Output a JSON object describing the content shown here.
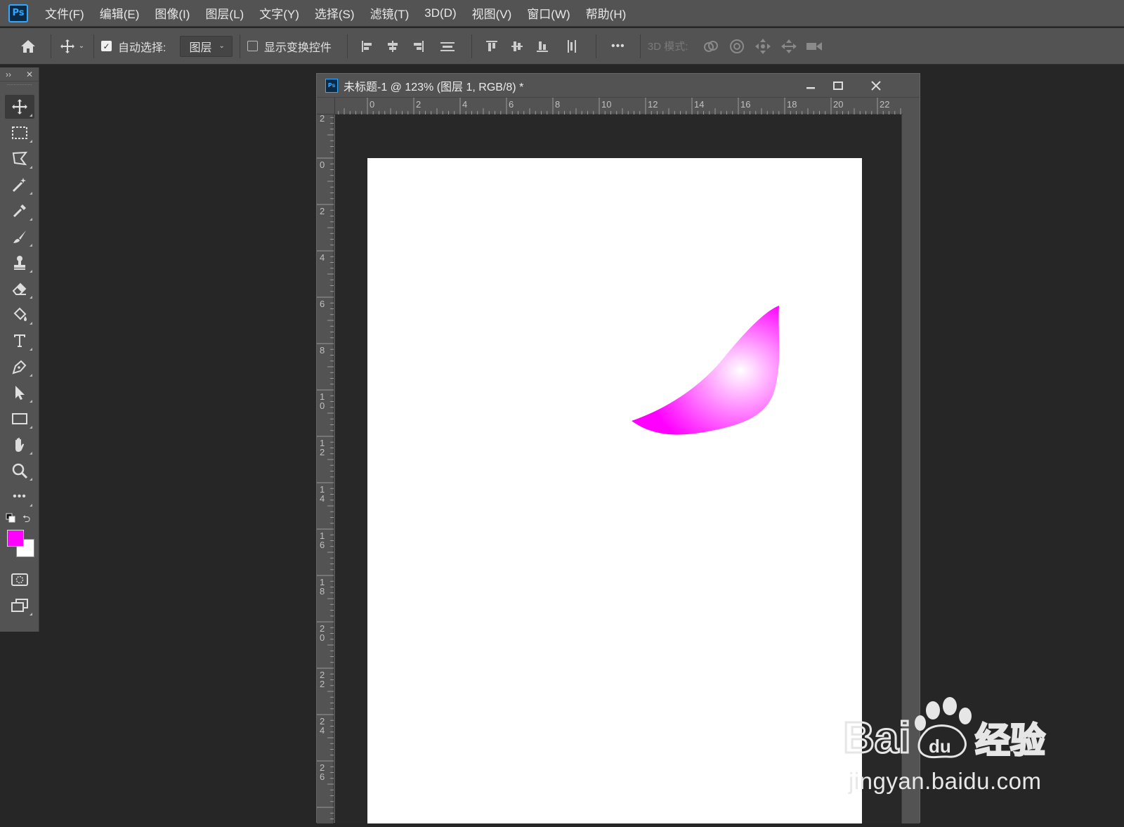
{
  "app": {
    "logo": "Ps"
  },
  "menu": [
    "文件(F)",
    "编辑(E)",
    "图像(I)",
    "图层(L)",
    "文字(Y)",
    "选择(S)",
    "滤镜(T)",
    "3D(D)",
    "视图(V)",
    "窗口(W)",
    "帮助(H)"
  ],
  "options": {
    "auto_select_label": "自动选择:",
    "auto_select_checked": true,
    "auto_select_target": "图层",
    "show_transform_label": "显示变换控件",
    "show_transform_checked": false,
    "more": "•••",
    "mode_3d_label": "3D 模式:"
  },
  "document": {
    "title": "未标题-1 @ 123% (图层 1, RGB/8) *",
    "ruler_top": [
      "0",
      "2",
      "4",
      "6",
      "8",
      "10",
      "12",
      "14",
      "16",
      "18",
      "20",
      "22"
    ],
    "ruler_left": [
      "2",
      "0",
      "2",
      "4",
      "6",
      "8",
      "10",
      "12",
      "14",
      "16",
      "18",
      "20",
      "22",
      "24",
      "26"
    ]
  },
  "colors": {
    "foreground": "#ff00ff",
    "background": "#ffffff",
    "shape_fill": "#ff00ff",
    "shape_highlight": "#ffffff"
  },
  "toolbar_icons": [
    "move-icon",
    "rectangular-marquee-icon",
    "polygonal-lasso-icon",
    "magic-wand-icon",
    "eyedropper-icon",
    "brush-icon",
    "clone-stamp-icon",
    "eraser-icon",
    "paint-bucket-icon",
    "type-icon",
    "pen-icon",
    "path-selection-icon",
    "rectangle-icon",
    "hand-icon",
    "zoom-icon",
    "more-tools-icon"
  ],
  "watermark": {
    "brand": "Bai 经验",
    "url": "jingyan.baidu.com"
  }
}
